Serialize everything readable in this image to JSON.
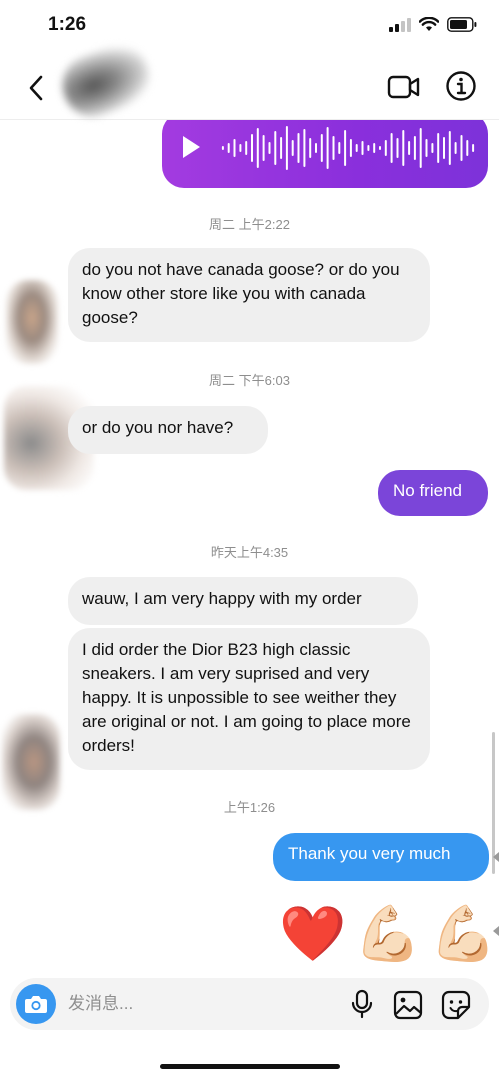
{
  "status": {
    "time": "1:26"
  },
  "colors": {
    "outgoing": "#3797f0",
    "outgoing_alt": "#7b45d9",
    "voice_start": "#a33be0",
    "voice_end": "#7d32d9"
  },
  "icons": {
    "back": "chevron-left-icon",
    "video": "video-camera-icon",
    "info": "info-circle-icon",
    "play": "play-icon",
    "camera": "camera-icon",
    "mic": "microphone-icon",
    "gallery": "image-icon",
    "sticker": "sticker-icon"
  },
  "messages": {
    "ts1": "周二 上午2:22",
    "in1": "do you not have canada goose? or do you know other store like you with canada goose?",
    "ts2": "周二 下午6:03",
    "in2": "or do you nor have?",
    "out1": "No friend",
    "ts3": "昨天上午4:35",
    "in3": "wauw, I am very happy with my order",
    "in4": "I did order the Dior B23 high classic sneakers. I am very suprised and very happy. It is unpossible to see weither they are original or not. I am going to place more orders!",
    "ts4": "上午1:26",
    "out2": "Thank you very much",
    "emojis": [
      "❤️",
      "💪🏻",
      "💪🏻"
    ]
  },
  "composer": {
    "placeholder": "发消息..."
  }
}
